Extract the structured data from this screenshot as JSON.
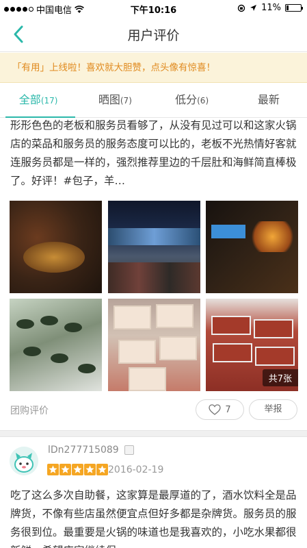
{
  "status_bar": {
    "carrier": "中国电信",
    "time": "下午10:16",
    "battery": "11%"
  },
  "nav": {
    "title": "用户评价"
  },
  "notice": "「有用」上线啦！喜欢就大胆赞，点头像有惊喜！",
  "tabs": [
    {
      "label": "全部",
      "count": "(17)",
      "active": true
    },
    {
      "label": "晒图",
      "count": "(7)",
      "active": false
    },
    {
      "label": "低分",
      "count": "(6)",
      "active": false
    },
    {
      "label": "最新",
      "count": "",
      "active": false
    }
  ],
  "review1": {
    "text": "形形色色的老板和服务员看够了，从没有见过可以和这家火锅店的菜品和服务员的服务态度可以比的，老板不光热情好客就连服务员都是一样的，强烈推荐里边的千层肚和海鲜简直棒极了。好评！#包子，羊…",
    "photo_count_label": "共7张",
    "source": "团购评价",
    "likes": "7",
    "report_label": "举报"
  },
  "review2": {
    "username": "lDn277715089",
    "rating": 5,
    "date": "2016-02-19",
    "text": "吃了这么多次自助餐，这家算是最厚道的了，酒水饮料全是品牌货，不像有些店虽然便宜点但好多都是杂牌货。服务员的服务很到位。最重要是火锅的味道也是我喜欢的，小吃水果都很新鲜，希望店家继续保"
  },
  "colors": {
    "accent": "#2bb8aa",
    "notice_text": "#e08a1e",
    "star": "#f5a623"
  }
}
